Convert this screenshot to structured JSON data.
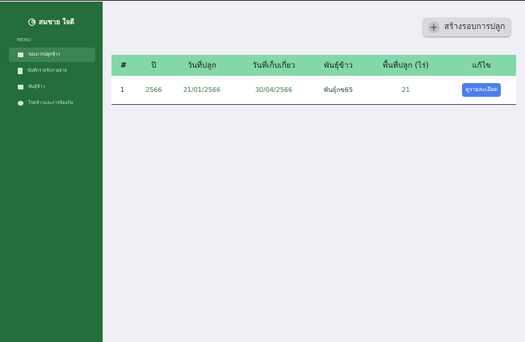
{
  "sidebar": {
    "user_name": "สมชาย ใจดี",
    "menu_label": "MENU",
    "items": [
      {
        "label": "รอบการปลูกข้าว",
        "icon": "calendar-icon",
        "active": true
      },
      {
        "label": "บันทึกรายรับรายจ่าย",
        "icon": "clipboard-icon",
        "active": false
      },
      {
        "label": "พันธุ์ข้าว",
        "icon": "list-icon",
        "active": false
      },
      {
        "label": "โรคข้าวและการป้องกัน",
        "icon": "chat-icon",
        "active": false
      }
    ]
  },
  "toolbar": {
    "create_label": "สร้างรอบการปลูก",
    "create_icon": "plus-icon"
  },
  "table": {
    "headers": [
      "#",
      "ปี",
      "วันที่ปลูก",
      "วันที่เก็บเกี่ยว",
      "พันธุ์ข้าว",
      "พื้นที่ปลูก (ไร่)",
      "แก้ไข"
    ],
    "rows": [
      {
        "num": "1",
        "year": "2566",
        "plant_date": "21/01/2566",
        "harvest_date": "30/04/2566",
        "variety": "พันธุ์กข65",
        "area": "21",
        "action_label": "ดูรายละเอียด"
      }
    ]
  },
  "colors": {
    "sidebar": "#236e3a",
    "header_row": "#83d8a9",
    "action_button": "#4a7ff0"
  }
}
